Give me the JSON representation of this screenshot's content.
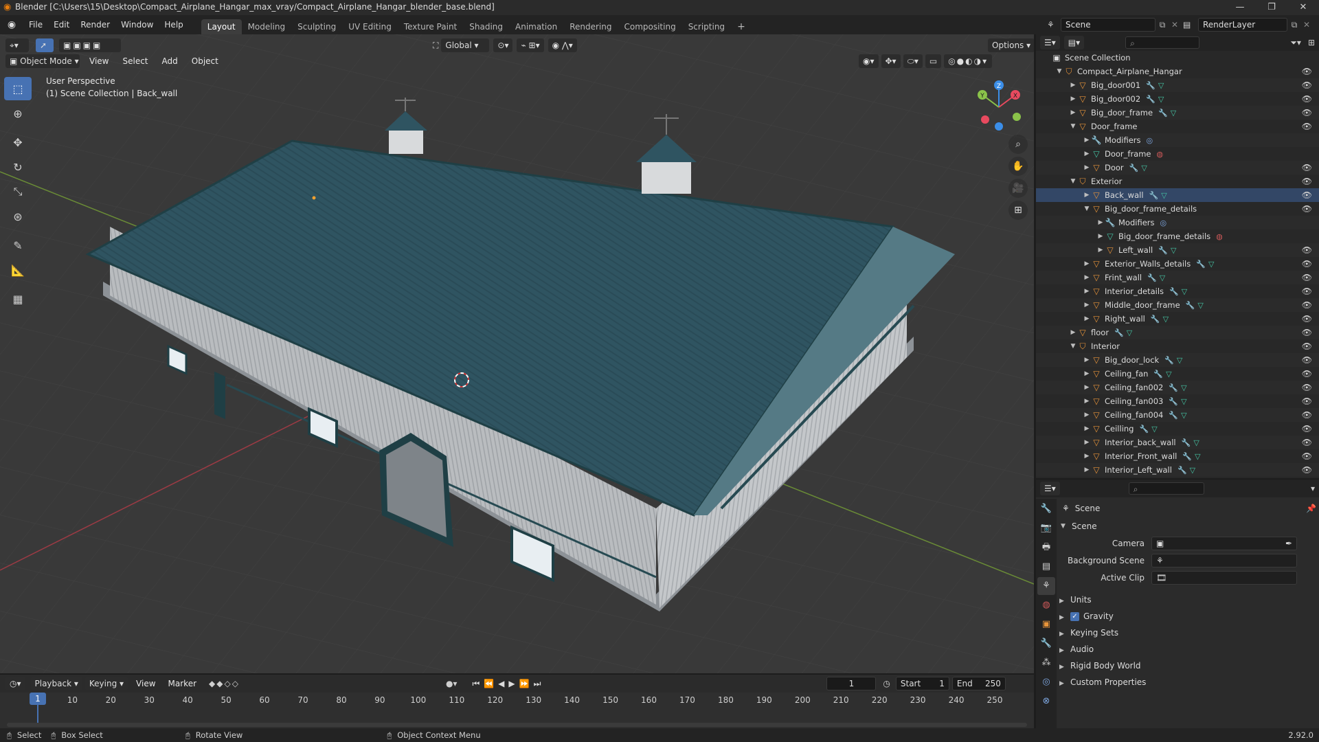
{
  "title_bar": {
    "title": "Blender [C:\\Users\\15\\Desktop\\Compact_Airplane_Hangar_max_vray/Compact_Airplane_Hangar_blender_base.blend]"
  },
  "menu": [
    "File",
    "Edit",
    "Render",
    "Window",
    "Help"
  ],
  "workspaces": [
    "Layout",
    "Modeling",
    "Sculpting",
    "UV Editing",
    "Texture Paint",
    "Shading",
    "Animation",
    "Rendering",
    "Compositing",
    "Scripting"
  ],
  "active_workspace": "Layout",
  "scene": {
    "name": "Scene",
    "view_layer": "RenderLayer"
  },
  "viewport": {
    "mode": "Object Mode",
    "header_menus": [
      "View",
      "Select",
      "Add",
      "Object"
    ],
    "orientation": "Global",
    "options_label": "Options",
    "overlay_text_1": "User Perspective",
    "overlay_text_2": "(1) Scene Collection | Back_wall",
    "gizmo_labels": {
      "z": "Z",
      "y": "Y",
      "x": "X"
    }
  },
  "outliner": {
    "root": "Scene Collection",
    "rows": [
      {
        "label": "Compact_Airplane_Hangar",
        "depth": 0,
        "type": "collection",
        "expanded": true,
        "eye": true
      },
      {
        "label": "Big_door001",
        "depth": 1,
        "type": "object",
        "expanded": false,
        "eye": true,
        "extras": "mod-mesh"
      },
      {
        "label": "Big_door002",
        "depth": 1,
        "type": "object",
        "expanded": false,
        "eye": true,
        "extras": "mod-mesh"
      },
      {
        "label": "Big_door_frame",
        "depth": 1,
        "type": "object",
        "expanded": false,
        "eye": true,
        "extras": "mod-mesh"
      },
      {
        "label": "Door_frame",
        "depth": 1,
        "type": "object",
        "expanded": true,
        "eye": true,
        "extras": ""
      },
      {
        "label": "Modifiers",
        "depth": 2,
        "type": "modifiers",
        "expanded": false,
        "eye": false,
        "extras": "modifier"
      },
      {
        "label": "Door_frame",
        "depth": 2,
        "type": "mesh",
        "expanded": false,
        "eye": false,
        "extras": "material"
      },
      {
        "label": "Door",
        "depth": 2,
        "type": "object",
        "expanded": false,
        "eye": true,
        "extras": "mod-mesh"
      },
      {
        "label": "Exterior",
        "depth": 1,
        "type": "collection",
        "expanded": true,
        "eye": true,
        "extras": ""
      },
      {
        "label": "Back_wall",
        "depth": 2,
        "type": "object",
        "expanded": false,
        "eye": true,
        "extras": "mod-mesh"
      },
      {
        "label": "Big_door_frame_details",
        "depth": 2,
        "type": "object",
        "expanded": true,
        "eye": true,
        "extras": ""
      },
      {
        "label": "Modifiers",
        "depth": 3,
        "type": "modifiers",
        "expanded": false,
        "eye": false,
        "extras": "modifier"
      },
      {
        "label": "Big_door_frame_details",
        "depth": 3,
        "type": "mesh",
        "expanded": false,
        "eye": false,
        "extras": "material"
      },
      {
        "label": "Left_wall",
        "depth": 3,
        "type": "object",
        "expanded": false,
        "eye": true,
        "extras": "mod-mesh"
      },
      {
        "label": "Exterior_Walls_details",
        "depth": 2,
        "type": "object",
        "expanded": false,
        "eye": true,
        "extras": "mod-mesh"
      },
      {
        "label": "Frint_wall",
        "depth": 2,
        "type": "object",
        "expanded": false,
        "eye": true,
        "extras": "mod-mesh"
      },
      {
        "label": "Interior_details",
        "depth": 2,
        "type": "object",
        "expanded": false,
        "eye": true,
        "extras": "mod-mesh"
      },
      {
        "label": "Middle_door_frame",
        "depth": 2,
        "type": "object",
        "expanded": false,
        "eye": true,
        "extras": "mod-mesh"
      },
      {
        "label": "Right_wall",
        "depth": 2,
        "type": "object",
        "expanded": false,
        "eye": true,
        "extras": "mod-mesh"
      },
      {
        "label": "floor",
        "depth": 1,
        "type": "object",
        "expanded": false,
        "eye": true,
        "extras": "mod-mesh"
      },
      {
        "label": "Interior",
        "depth": 1,
        "type": "collection",
        "expanded": true,
        "eye": true,
        "extras": ""
      },
      {
        "label": "Big_door_lock",
        "depth": 2,
        "type": "object",
        "expanded": false,
        "eye": true,
        "extras": "mod-mesh"
      },
      {
        "label": "Ceiling_fan",
        "depth": 2,
        "type": "object",
        "expanded": false,
        "eye": true,
        "extras": "mod-mesh"
      },
      {
        "label": "Ceiling_fan002",
        "depth": 2,
        "type": "object",
        "expanded": false,
        "eye": true,
        "extras": "mod-mesh"
      },
      {
        "label": "Ceiling_fan003",
        "depth": 2,
        "type": "object",
        "expanded": false,
        "eye": true,
        "extras": "mod-mesh"
      },
      {
        "label": "Ceiling_fan004",
        "depth": 2,
        "type": "object",
        "expanded": false,
        "eye": true,
        "extras": "mod-mesh"
      },
      {
        "label": "Ceilling",
        "depth": 2,
        "type": "object",
        "expanded": false,
        "eye": true,
        "extras": "mod-mesh"
      },
      {
        "label": "Interior_back_wall",
        "depth": 2,
        "type": "object",
        "expanded": false,
        "eye": true,
        "extras": "mod-mesh"
      },
      {
        "label": "Interior_Front_wall",
        "depth": 2,
        "type": "object",
        "expanded": false,
        "eye": true,
        "extras": "mod-mesh"
      },
      {
        "label": "Interior_Left_wall",
        "depth": 2,
        "type": "object",
        "expanded": false,
        "eye": true,
        "extras": "mod-mesh"
      }
    ]
  },
  "properties": {
    "context_name": "Scene",
    "section": "Scene",
    "fields": [
      {
        "label": "Camera",
        "value": ""
      },
      {
        "label": "Background Scene",
        "value": ""
      },
      {
        "label": "Active Clip",
        "value": ""
      }
    ],
    "panels": [
      {
        "label": "Units",
        "checkbox": false
      },
      {
        "label": "Gravity",
        "checkbox": true
      },
      {
        "label": "Keying Sets",
        "checkbox": false
      },
      {
        "label": "Audio",
        "checkbox": false
      },
      {
        "label": "Rigid Body World",
        "checkbox": false
      },
      {
        "label": "Custom Properties",
        "checkbox": false
      }
    ]
  },
  "timeline": {
    "menus": [
      "Playback",
      "Keying",
      "View",
      "Marker"
    ],
    "current_frame": "1",
    "start_label": "Start",
    "start": "1",
    "end_label": "End",
    "end": "250",
    "ticks": [
      "1",
      "10",
      "20",
      "30",
      "40",
      "50",
      "60",
      "70",
      "80",
      "90",
      "100",
      "110",
      "120",
      "130",
      "140",
      "150",
      "160",
      "170",
      "180",
      "190",
      "200",
      "210",
      "220",
      "230",
      "240",
      "250"
    ]
  },
  "status_bar": {
    "select": "Select",
    "box_select": "Box Select",
    "rotate_view": "Rotate View",
    "context_menu": "Object Context Menu",
    "version": "2.92.0"
  },
  "colors": {
    "accent": "#4772b3",
    "roof": "#2f5461",
    "wall": "#b9bcbf",
    "trim": "#1f3f45",
    "axis_x": "#e84a5f",
    "axis_y": "#8bc34a",
    "axis_z": "#3b8ee8",
    "object_icon": "#e8943a",
    "mesh_icon": "#45c6a5",
    "modifier_icon": "#7ea7e0"
  }
}
